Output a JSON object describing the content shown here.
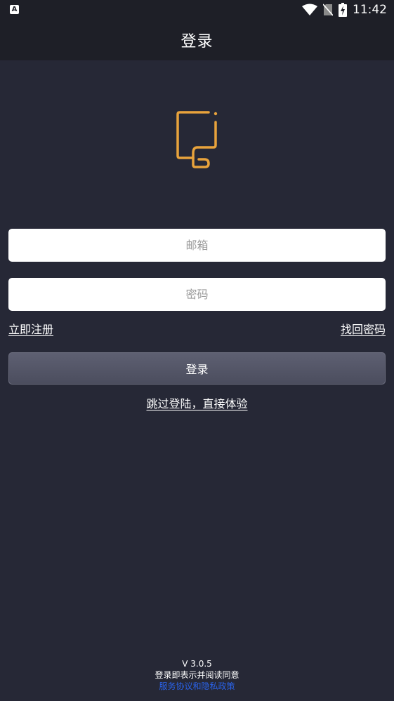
{
  "status_bar": {
    "left_icon_letter": "A",
    "time": "11:42",
    "icons": [
      "wifi-icon",
      "no-sim-icon",
      "battery-charging-icon"
    ]
  },
  "app_bar": {
    "title": "登录"
  },
  "logo": {
    "icon": "document-logo-icon",
    "color": "#e8a33c"
  },
  "form": {
    "email_placeholder": "邮箱",
    "email_value": "",
    "password_placeholder": "密码",
    "password_value": "",
    "register_link": "立即注册",
    "forgot_link": "找回密码",
    "login_button": "登录",
    "skip_link": "跳过登陆，直接体验"
  },
  "footer": {
    "version": "V 3.0.5",
    "agreement_text": "登录即表示并阅读同意",
    "policy_link": "服务协议和隐私政策",
    "policy_color": "#2a62e8"
  },
  "colors": {
    "background": "#262836",
    "bar": "#1e1f27",
    "accent": "#e8a33c"
  }
}
